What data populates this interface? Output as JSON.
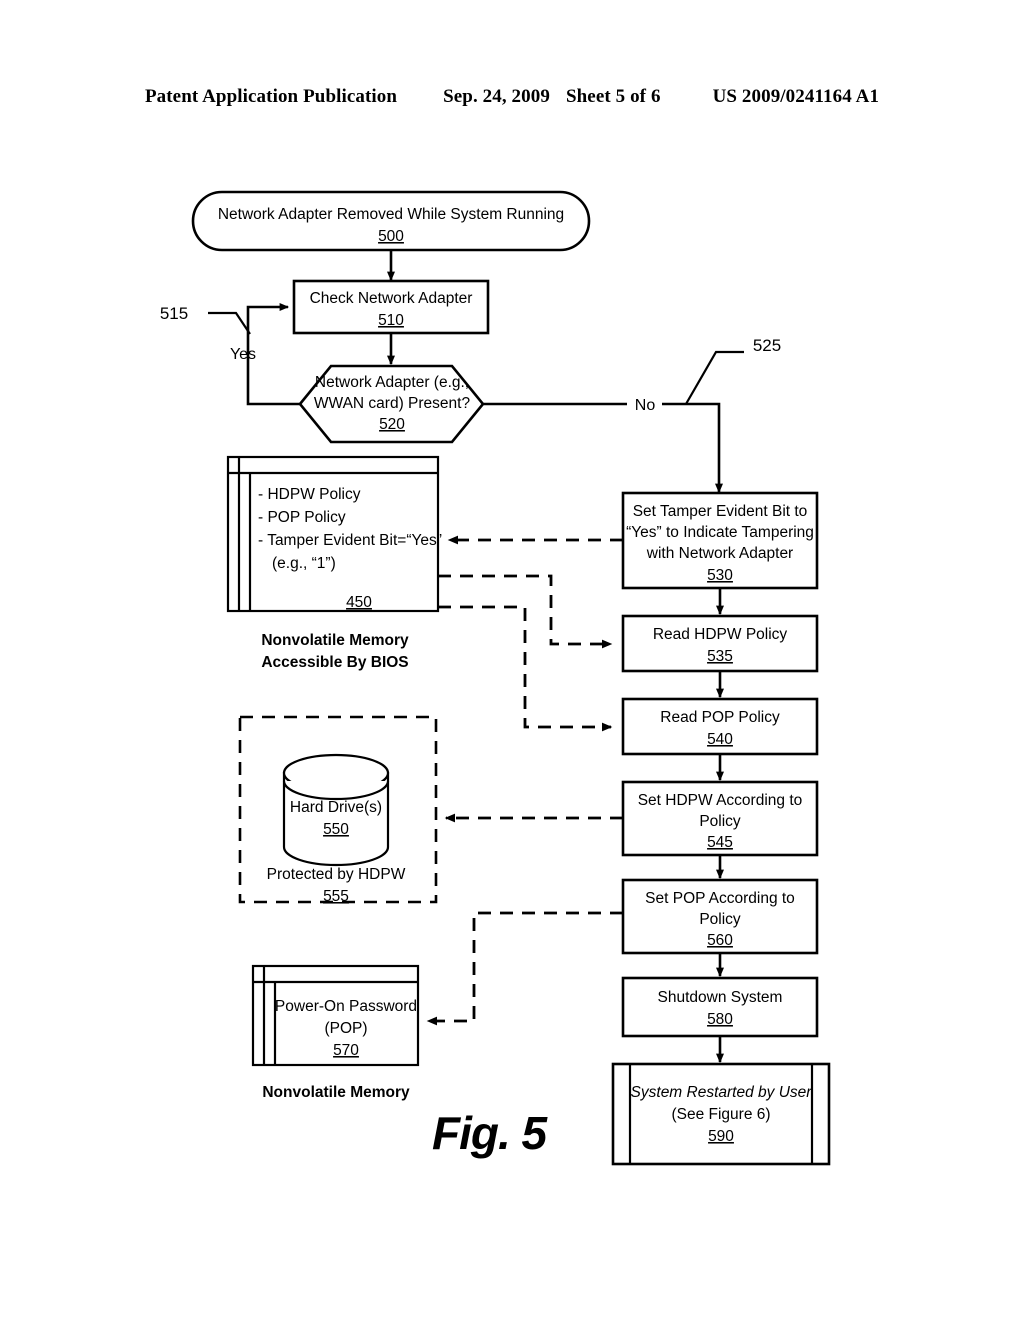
{
  "header": {
    "publication": "Patent Application Publication",
    "date": "Sep. 24, 2009",
    "sheet": "Sheet 5 of 6",
    "patent_number": "US 2009/0241164 A1"
  },
  "figure": {
    "caption": "Fig. 5"
  },
  "nodes": {
    "start": {
      "text": "Network Adapter Removed While System Running",
      "ref": "500"
    },
    "check": {
      "text": "Check Network Adapter",
      "ref": "510"
    },
    "decision": {
      "line1": "Network Adapter (e.g.,",
      "line2": "WWAN card) Present?",
      "ref": "520"
    },
    "set_tamper": {
      "line1": "Set Tamper Evident Bit to",
      "line2": "“Yes” to Indicate Tampering",
      "line3": "with Network Adapter",
      "ref": "530"
    },
    "read_hdpw": {
      "text": "Read HDPW Policy",
      "ref": "535"
    },
    "read_pop": {
      "text": "Read POP Policy",
      "ref": "540"
    },
    "set_hdpw": {
      "line1": "Set HDPW According to",
      "line2": "Policy",
      "ref": "545"
    },
    "set_pop": {
      "line1": "Set POP According to",
      "line2": "Policy",
      "ref": "560"
    },
    "shutdown": {
      "text": "Shutdown System",
      "ref": "580"
    },
    "restart": {
      "line1": "System Restarted by User",
      "line2": "(See Figure 6)",
      "ref": "590"
    },
    "nvram_bios": {
      "item1": "- HDPW Policy",
      "item2": "- POP Policy",
      "item3": "- Tamper Evident Bit=“Yes”",
      "item4": "(e.g., “1”)",
      "ref": "450",
      "caption_line1": "Nonvolatile Memory",
      "caption_line2": "Accessible By BIOS"
    },
    "hard_drive": {
      "text": "Hard Drive(s)",
      "ref": "550",
      "protected_text": "Protected by HDPW",
      "protected_ref": "555"
    },
    "pop_memory": {
      "line1": "Power-On Password",
      "line2": "(POP)",
      "ref": "570",
      "caption": "Nonvolatile Memory"
    }
  },
  "edges": {
    "yes_label": "Yes",
    "no_label": "No",
    "yes_ref": "515",
    "no_ref": "525"
  }
}
